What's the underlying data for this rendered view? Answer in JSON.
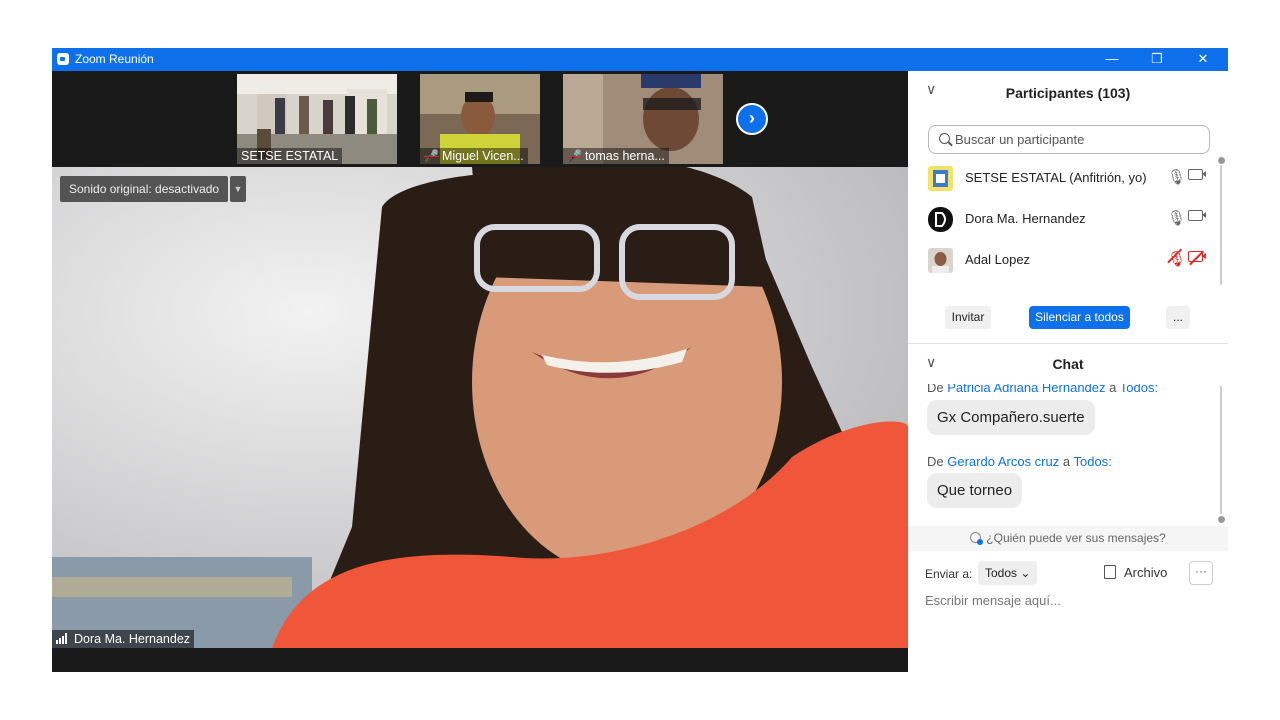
{
  "window": {
    "title": "Zoom Reunión",
    "controls": {
      "minimize": "—",
      "restore": "❐",
      "close": "✕"
    }
  },
  "thumbnails": [
    {
      "name": "SETSE ESTATAL",
      "muted": false
    },
    {
      "name": "Miguel Vicen...",
      "muted": true
    },
    {
      "name": "tomas herna...",
      "muted": true
    }
  ],
  "next_arrow": "›",
  "main_video": {
    "sound_button": "Sonido original: desactivado",
    "sound_dropdown": "▼",
    "speaker_name": "Dora Ma. Hernandez"
  },
  "participants": {
    "title": "Participantes (103)",
    "collapse_icon": "∨",
    "search_placeholder": "Buscar un participante",
    "list": [
      {
        "name": "SETSE ESTATAL (Anfitrión, yo)",
        "mic": "on",
        "video": "on"
      },
      {
        "name": "Dora Ma. Hernandez",
        "mic": "on",
        "video": "on"
      },
      {
        "name": "Adal Lopez",
        "mic": "muted",
        "video": "off"
      }
    ],
    "buttons": {
      "invite": "Invitar",
      "mute_all": "Silenciar a todos",
      "more": "..."
    }
  },
  "chat": {
    "title": "Chat",
    "collapse_icon": "∨",
    "messages": [
      {
        "prefix": "De",
        "from": "Patricia Adriana Hernandez",
        "to_word": "a",
        "to": "Todos:",
        "text": "Gx Compañero.suerte"
      },
      {
        "prefix": "De",
        "from": "Gerardo Arcos cruz",
        "to_word": "a",
        "to": "Todos:",
        "text": "Que torneo"
      }
    ],
    "who_can_see": "¿Quién puede ver sus mensajes?",
    "send_to_label": "Enviar a:",
    "send_to_value": "Todos",
    "send_to_chevron": "⌄",
    "file_label": "Archivo",
    "more_label": "···",
    "input_placeholder": "Escribir mensaje aquí..."
  },
  "colors": {
    "zoom_blue": "#0e71eb",
    "muted_red": "#e02828",
    "video_bg": "#1a1a1a"
  }
}
